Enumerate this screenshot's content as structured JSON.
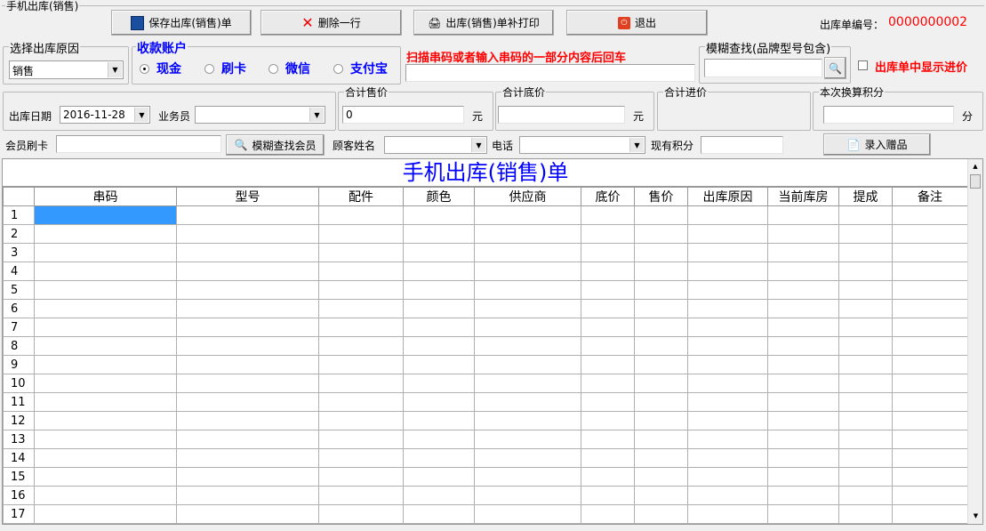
{
  "window": {
    "title": "手机出库(销售)"
  },
  "toolbar": {
    "save": "保存出库(销售)单",
    "delete_row": "删除一行",
    "reprint": "出库(销售)单补打印",
    "exit": "退出"
  },
  "order_no": {
    "label": "出库单编号：",
    "value": "0000000002"
  },
  "reason": {
    "legend": "选择出库原因",
    "value": "销售"
  },
  "account": {
    "legend": "收款账户",
    "options": [
      "现金",
      "刷卡",
      "微信",
      "支付宝"
    ],
    "selected": 0
  },
  "scan": {
    "label": "扫描串码或者输入串码的一部分内容后回车",
    "value": ""
  },
  "fuzzy": {
    "legend": "模糊查找(品牌型号包含)",
    "value": ""
  },
  "show_cost": {
    "label": "出库单中显示进价",
    "checked": false
  },
  "date": {
    "label": "出库日期",
    "value": "2016-11-28"
  },
  "clerk": {
    "label": "业务员",
    "value": ""
  },
  "total_sale": {
    "legend": "合计售价",
    "value": "0",
    "unit": "元"
  },
  "total_base": {
    "legend": "合计底价",
    "value": "",
    "unit": "元"
  },
  "total_cost": {
    "legend": "合计进价"
  },
  "points": {
    "legend": "本次换算积分",
    "value": "",
    "unit": "分"
  },
  "member": {
    "card_label": "会员刷卡",
    "card_value": "",
    "search": "模糊查找会员",
    "name_label": "顾客姓名",
    "phone_label": "电话",
    "points_label": "现有积分",
    "gift": "录入赠品"
  },
  "grid": {
    "title": "手机出库(销售)单",
    "columns": [
      "串码",
      "型号",
      "配件",
      "颜色",
      "供应商",
      "底价",
      "售价",
      "出库原因",
      "当前库房",
      "提成",
      "备注"
    ],
    "rows": [
      "1",
      "2",
      "3",
      "4",
      "5",
      "6",
      "7",
      "8",
      "9",
      "10",
      "11",
      "12",
      "13",
      "14",
      "15",
      "16",
      "17"
    ]
  }
}
